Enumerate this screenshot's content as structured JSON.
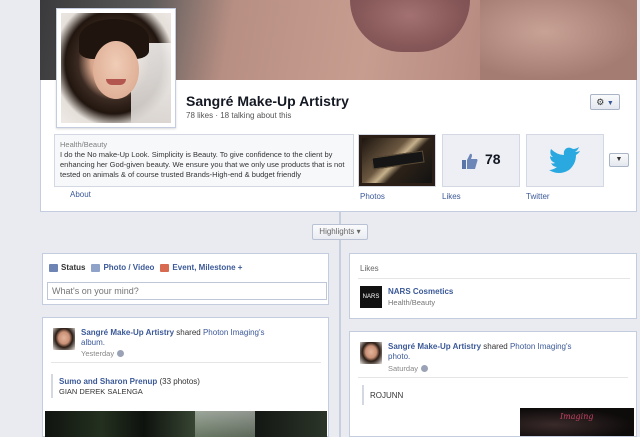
{
  "page": {
    "title": "Sangré Make-Up Artistry",
    "stats": "78 likes · 18 talking about this",
    "gear_label": "⚙"
  },
  "about": {
    "category": "Health/Beauty",
    "text": "I do the No make-Up Look. Simplicity is Beauty. To give confidence to the client by enhancing her God-given beauty. We ensure you that we only use products that is not tested on animals & of course trusted Brands-High-end & budget friendly",
    "link": "About"
  },
  "tiles": {
    "photos_label": "Photos",
    "likes_count": "78",
    "likes_label": "Likes",
    "twitter_label": "Twitter"
  },
  "timeline": {
    "highlights_label": "Highlights"
  },
  "composer": {
    "tabs": [
      "Status",
      "Photo / Video",
      "Event, Milestone +"
    ],
    "placeholder": "What's on your mind?"
  },
  "likes_box": {
    "heading": "Likes",
    "page_name": "NARS Cosmetics",
    "page_category": "Health/Beauty",
    "logo_text": "NARS"
  },
  "posts": [
    {
      "author": "Sangré Make-Up Artistry",
      "action": " shared ",
      "source": "Photon Imaging's",
      "object": "album.",
      "time": "Yesterday",
      "album_title": "Sumo and Sharon Prenup",
      "album_count": " (33 photos)",
      "album_sub": "GIAN DEREK SALENGA"
    },
    {
      "author": "Sangré Make-Up Artistry",
      "action": " shared ",
      "source": "Photon Imaging's",
      "object": "photo.",
      "time": "Saturday",
      "caption": "ROJUNN",
      "signature": "Imaging"
    }
  ],
  "colors": {
    "link": "#3b5998",
    "border": "#c4cde0",
    "background": "#e9ebf0",
    "twitter": "#2aa9e0"
  }
}
